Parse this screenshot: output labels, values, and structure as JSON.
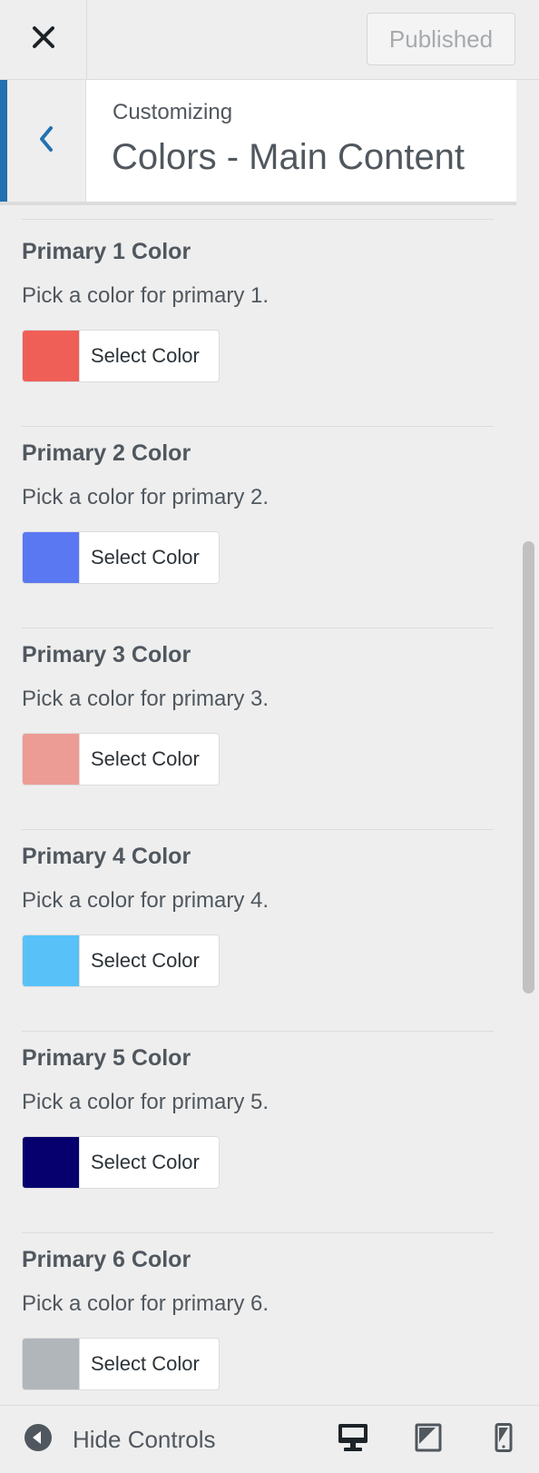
{
  "header": {
    "close_label": "close",
    "publish_label": "Published"
  },
  "section": {
    "subtitle": "Customizing",
    "title": "Colors - Main Content"
  },
  "controls": [
    {
      "title": "Primary 1 Color",
      "description": "Pick a color for primary 1.",
      "button_label": "Select Color",
      "color": "#ef5f57"
    },
    {
      "title": "Primary 2 Color",
      "description": "Pick a color for primary 2.",
      "button_label": "Select Color",
      "color": "#5a78f2"
    },
    {
      "title": "Primary 3 Color",
      "description": "Pick a color for primary 3.",
      "button_label": "Select Color",
      "color": "#ec9c94"
    },
    {
      "title": "Primary 4 Color",
      "description": "Pick a color for primary 4.",
      "button_label": "Select Color",
      "color": "#58c1f8"
    },
    {
      "title": "Primary 5 Color",
      "description": "Pick a color for primary 5.",
      "button_label": "Select Color",
      "color": "#05006d"
    },
    {
      "title": "Primary 6 Color",
      "description": "Pick a color for primary 6.",
      "button_label": "Select Color",
      "color": "#b0b6ba"
    }
  ],
  "footer": {
    "hide_controls_label": "Hide Controls",
    "devices": [
      "desktop",
      "tablet",
      "mobile"
    ],
    "active_device": "desktop"
  },
  "theme": {
    "accent": "#2271b1",
    "text": "#50575e",
    "background": "#eeeeee"
  }
}
